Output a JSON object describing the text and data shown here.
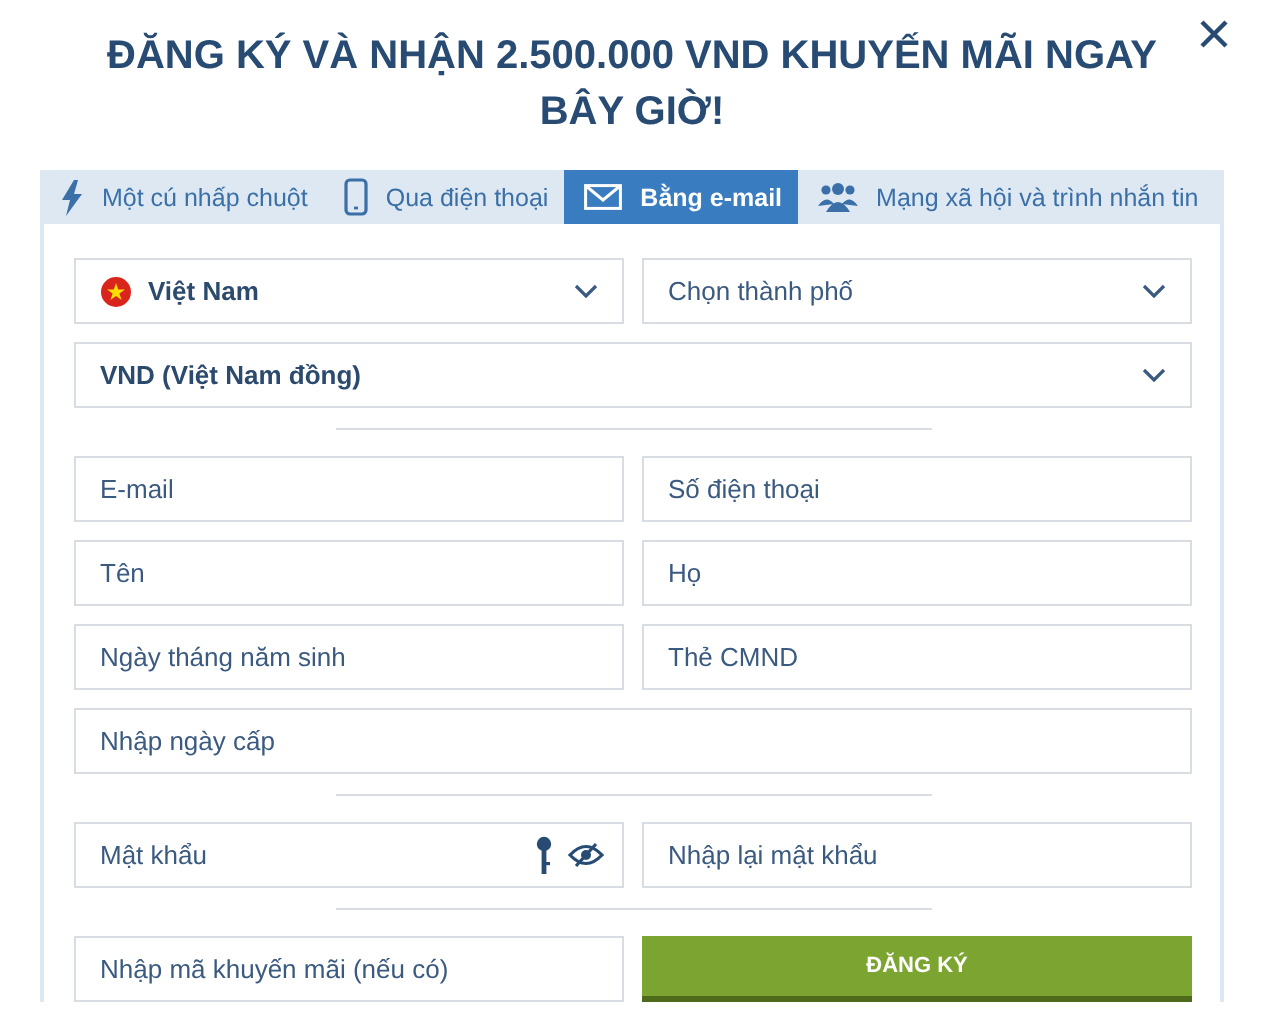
{
  "title": "ĐĂNG KÝ VÀ NHẬN 2.500.000 VND KHUYẾN MÃI NGAY BÂY GIỜ!",
  "tabs": [
    {
      "label": "Một cú nhấp chuột",
      "selected": false
    },
    {
      "label": "Qua điện thoại",
      "selected": false
    },
    {
      "label": "Bằng e-mail",
      "selected": true
    },
    {
      "label": "Mạng xã hội và trình nhắn tin",
      "selected": false
    }
  ],
  "location": {
    "country": {
      "value": "Việt Nam"
    },
    "city": {
      "placeholder": "Chọn thành phố"
    }
  },
  "currency": {
    "value": "VND (Việt Nam đồng)"
  },
  "fields": [
    {
      "placeholder": "E-mail"
    },
    {
      "placeholder": "Số điện thoại"
    },
    {
      "placeholder": "Tên"
    },
    {
      "placeholder": "Họ"
    },
    {
      "placeholder": "Ngày tháng năm sinh"
    },
    {
      "placeholder": "Thẻ CMND"
    }
  ],
  "issue_date": {
    "placeholder": "Nhập ngày cấp"
  },
  "password": {
    "placeholder": "Mật khẩu"
  },
  "password_confirm": {
    "placeholder": "Nhập lại mật khẩu"
  },
  "promo_code": {
    "placeholder": "Nhập mã khuyến mãi (nếu có)"
  },
  "submit_button": "ĐĂNG KÝ"
}
